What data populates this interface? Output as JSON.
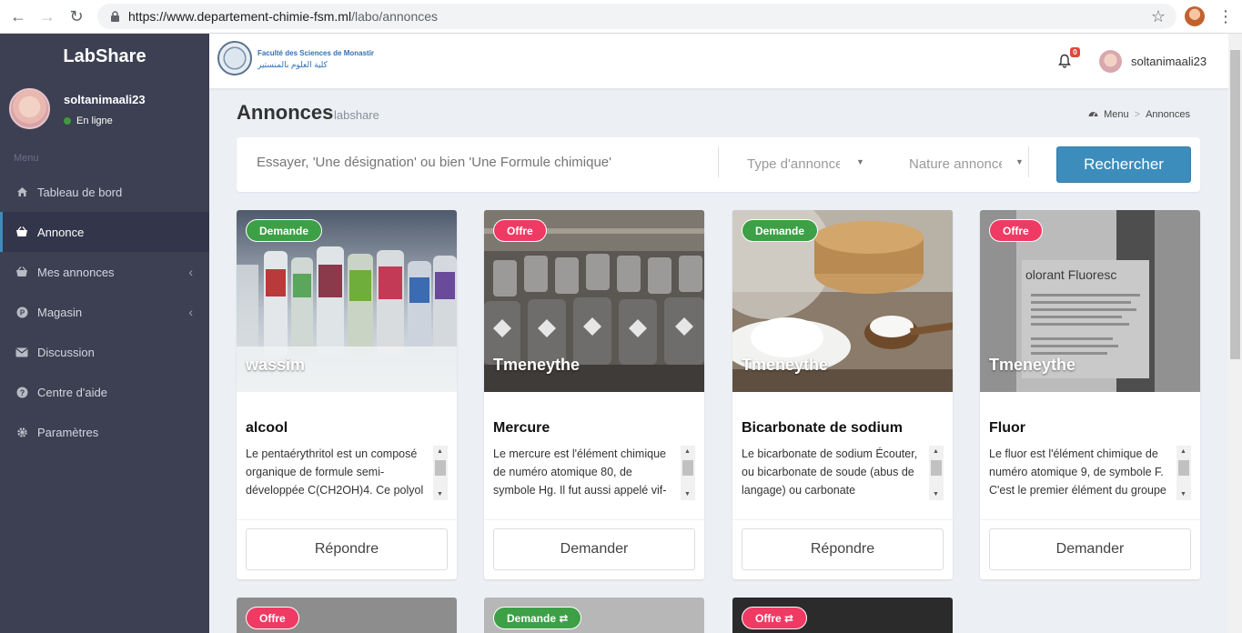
{
  "browser": {
    "url_domain": "https://www.departement-chimie-fsm.ml",
    "url_path": "/labo/annonces"
  },
  "sidebar": {
    "brand": "LabShare",
    "user_name": "soltanimaali23",
    "user_status": "En ligne",
    "menu_header": "Menu",
    "items": [
      {
        "label": "Tableau de bord",
        "icon": "home-icon"
      },
      {
        "label": "Annonce",
        "icon": "basket-icon"
      },
      {
        "label": "Mes annonces",
        "icon": "basket-icon"
      },
      {
        "label": "Magasin",
        "icon": "parking-icon"
      },
      {
        "label": "Discussion",
        "icon": "envelope-icon"
      },
      {
        "label": "Centre d'aide",
        "icon": "question-icon"
      },
      {
        "label": "Paramètres",
        "icon": "gear-icon"
      }
    ]
  },
  "topbar": {
    "logo_fr": "Faculté des Sciences de Monastir",
    "logo_ar": "كلية العلوم بالمنستير",
    "notification_count": "0",
    "user_name": "soltanimaali23"
  },
  "header": {
    "title": "Annonces",
    "subtitle": "labshare",
    "breadcrumb_root": "Menu",
    "breadcrumb_current": "Annonces"
  },
  "search": {
    "placeholder": "Essayer, 'Une désignation' ou bien 'Une Formule chimique'",
    "type_placeholder": "Type d'annonce",
    "nature_placeholder": "Nature annonce",
    "button": "Rechercher"
  },
  "cards": [
    {
      "badge": "Demande",
      "author": "wassim",
      "title": "alcool",
      "desc": "Le pentaérythritol est un composé organique de formule semi-développée C(CH2OH)4. Ce polyol",
      "button": "Répondre"
    },
    {
      "badge": "Offre",
      "author": "Tmeneythe",
      "title": "Mercure",
      "desc": "Le mercure est l'élément chimique de numéro atomique 80, de symbole Hg. Il fut aussi appelé vif-",
      "button": "Demander"
    },
    {
      "badge": "Demande",
      "author": "Tmeneythe",
      "title": "Bicarbonate de sodium",
      "desc": "Le bicarbonate de sodium Écouter, ou bicarbonate de soude (abus de langage) ou carbonate",
      "button": "Répondre"
    },
    {
      "badge": "Offre",
      "author": "Tmeneythe",
      "title": "Fluor",
      "desc": "Le fluor est l'élément chimique de numéro atomique 9, de symbole F. C'est le premier élément du groupe",
      "button": "Demander"
    }
  ],
  "partial_cards": [
    {
      "badge": "Offre"
    },
    {
      "badge": "Demande ⇄"
    },
    {
      "badge": "Offre ⇄"
    }
  ],
  "colors": {
    "sidebar_bg": "#3d4053",
    "accent": "#3c8dbc",
    "demande": "#3da046",
    "offre": "#ef3a64"
  }
}
